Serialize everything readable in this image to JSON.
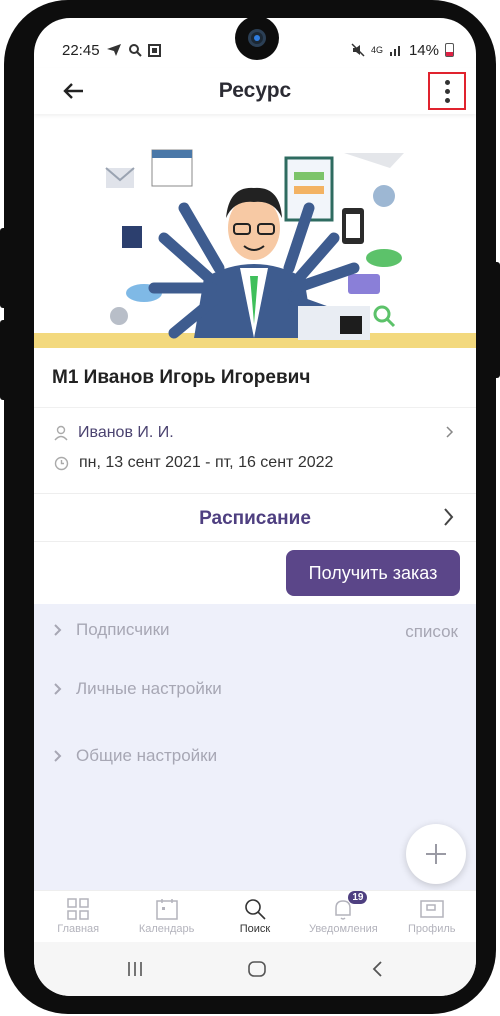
{
  "status_bar": {
    "time": "22:45",
    "network": "4G",
    "battery": "14%"
  },
  "header": {
    "title": "Ресурс"
  },
  "resource": {
    "name": "М1 Иванов Игорь Игоревич",
    "owner": "Иванов И. И.",
    "period": "пн, 13 сент 2021 - пт, 16 сент 2022",
    "schedule_label": "Расписание",
    "order_button": "Получить заказ"
  },
  "settings": {
    "items": [
      {
        "label": "Подписчики",
        "value": "список"
      },
      {
        "label": "Личные настройки"
      },
      {
        "label": "Общие настройки"
      }
    ]
  },
  "tabs": [
    {
      "label": "Главная",
      "icon": "grid-icon"
    },
    {
      "label": "Календарь",
      "icon": "calendar-icon"
    },
    {
      "label": "Поиск",
      "icon": "search-icon",
      "active": true
    },
    {
      "label": "Уведомления",
      "icon": "bell-icon",
      "badge": "19"
    },
    {
      "label": "Профиль",
      "icon": "profile-icon"
    }
  ],
  "colors": {
    "accent": "#5b4689",
    "highlight": "#e0232e",
    "settings_bg": "#eef0fa"
  }
}
